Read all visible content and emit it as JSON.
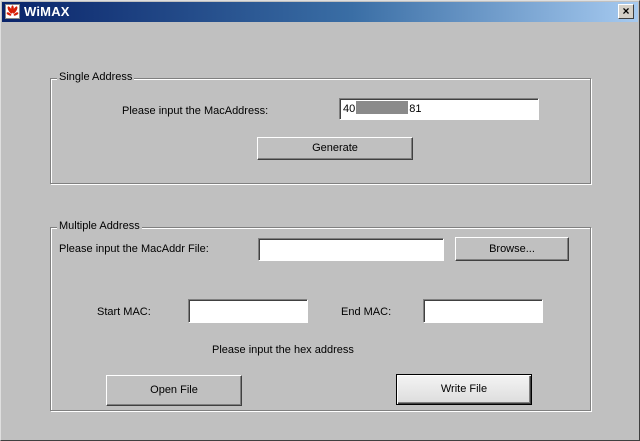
{
  "window": {
    "title": "WiMAX",
    "close_glyph": "×",
    "icon": "huawei-logo-icon"
  },
  "single": {
    "legend": "Single Address",
    "mac_label": "Please input the MacAddress:",
    "mac_value_start": "40",
    "mac_value_end": "81",
    "generate_label": "Generate"
  },
  "multiple": {
    "legend": "Multiple Address",
    "file_label": "Please input the MacAddr File:",
    "file_value": "",
    "browse_label": "Browse...",
    "start_label": "Start MAC:",
    "start_value": "",
    "end_label": "End MAC:",
    "end_value": "",
    "hint": "Please input the hex address",
    "open_label": "Open File",
    "write_label": "Write File"
  }
}
